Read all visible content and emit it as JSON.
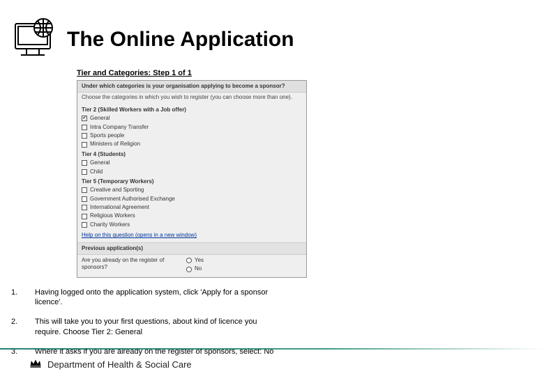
{
  "page_title": "The Online Application",
  "screenshot": {
    "step_heading": "Tier and Categories: Step 1 of 1",
    "question_heading": "Under which categories is your organisation applying to become a sponsor?",
    "question_sub": "Choose the categories in which you wish to register (you can choose more than one).",
    "tier2_label": "Tier 2 (Skilled Workers with a Job offer)",
    "tier2_options": [
      {
        "label": "General",
        "checked": true
      },
      {
        "label": "Intra Company Transfer",
        "checked": false
      },
      {
        "label": "Sports people",
        "checked": false
      },
      {
        "label": "Ministers of Religion",
        "checked": false
      }
    ],
    "tier4_label": "Tier 4 (Students)",
    "tier4_options": [
      {
        "label": "General",
        "checked": false
      },
      {
        "label": "Child",
        "checked": false
      }
    ],
    "tier5_label": "Tier 5 (Temporary Workers)",
    "tier5_options": [
      {
        "label": "Creative and Sporting",
        "checked": false
      },
      {
        "label": "Government Authorised Exchange",
        "checked": false
      },
      {
        "label": "International Agreement",
        "checked": false
      },
      {
        "label": "Religious Workers",
        "checked": false
      },
      {
        "label": "Charity Workers",
        "checked": false
      }
    ],
    "help_link": "Help on this question (opens in a new window)",
    "prev_app_heading": "Previous application(s)",
    "register_question": "Are you already on the register of sponsors?",
    "radio_yes": "Yes",
    "radio_no": "No"
  },
  "instructions": [
    {
      "num": "1.",
      "text": "Having logged onto the application system, click 'Apply for a sponsor licence'."
    },
    {
      "num": "2.",
      "text": "This will take you to your first questions, about kind of licence you require. Choose Tier 2: General"
    },
    {
      "num": "3.",
      "text": "Where it asks if you are already on the register of sponsors, select: No"
    }
  ],
  "footer": {
    "department": "Department of Health & Social Care"
  }
}
